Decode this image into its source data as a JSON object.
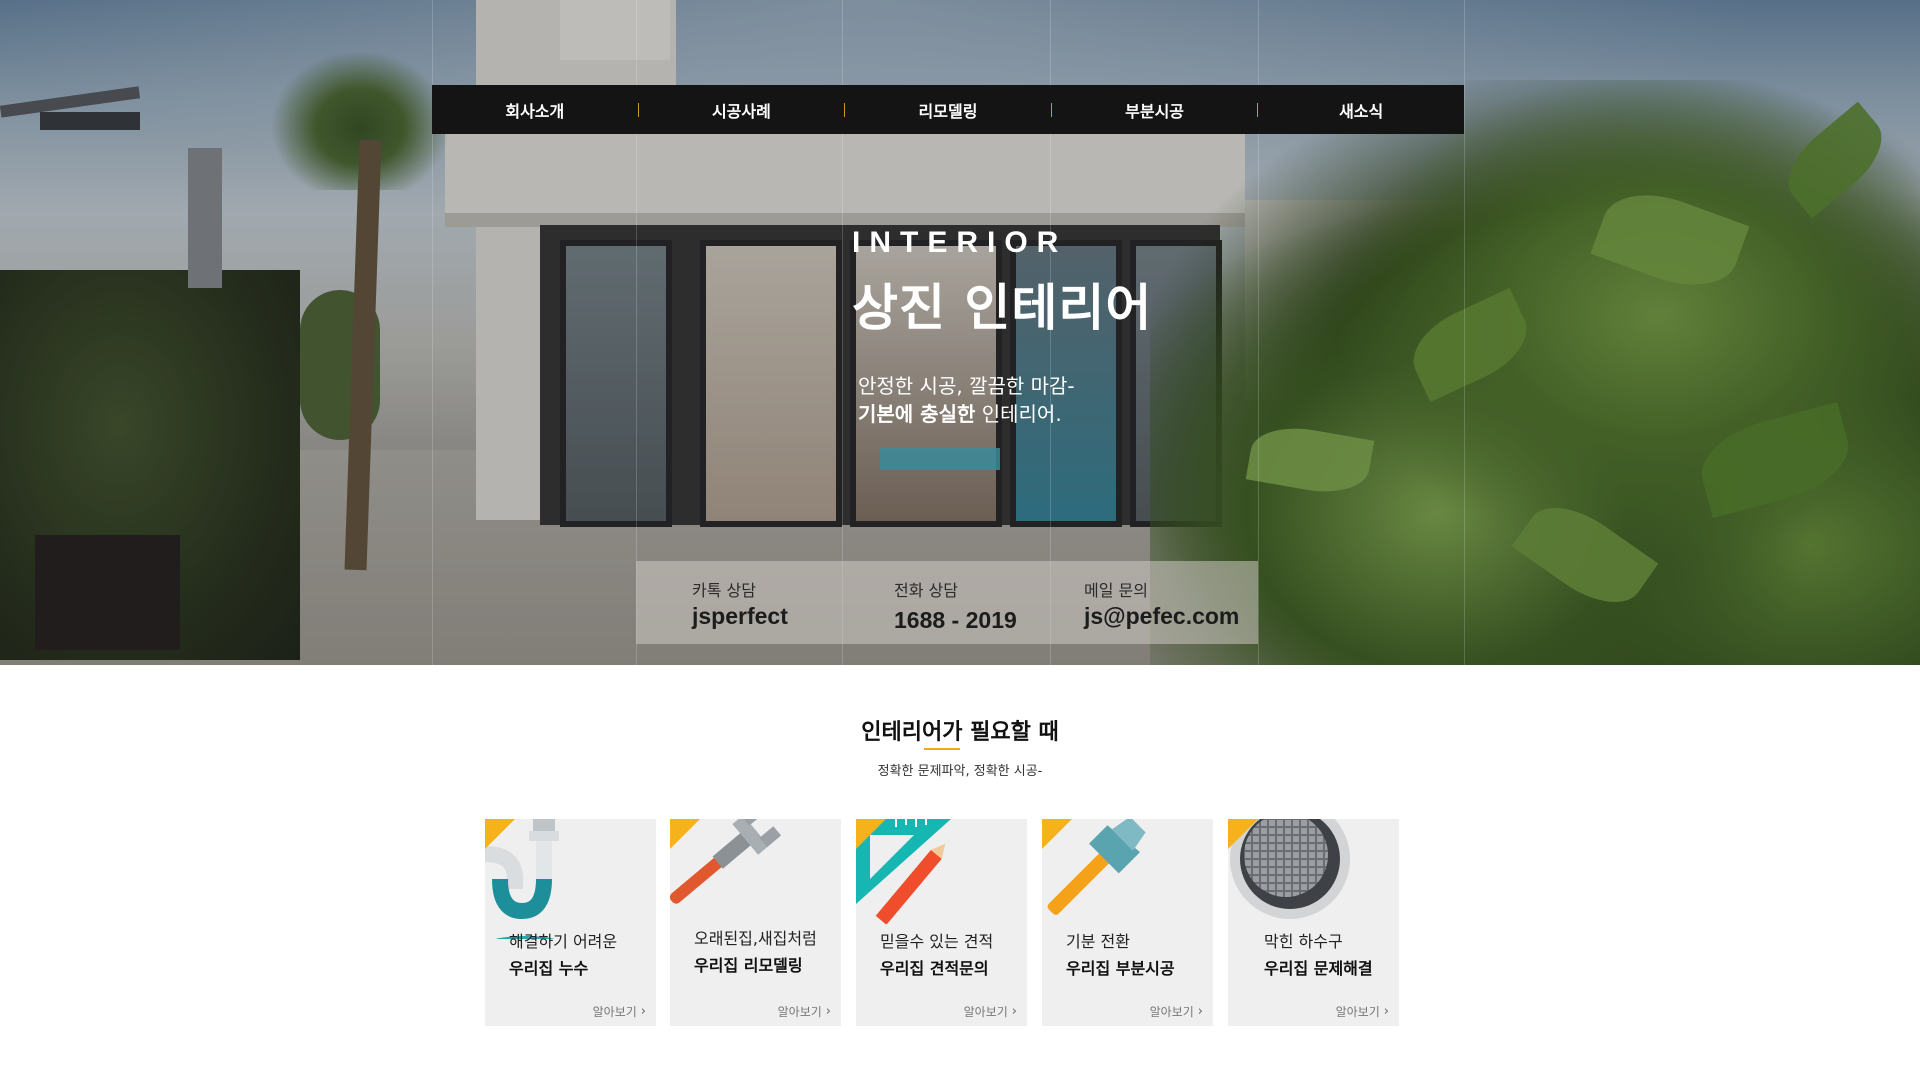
{
  "nav": {
    "items": [
      {
        "label": "회사소개"
      },
      {
        "label": "시공사례"
      },
      {
        "label": "리모델링"
      },
      {
        "label": "부분시공"
      },
      {
        "label": "새소식"
      }
    ]
  },
  "hero": {
    "eyebrow": "INTERIOR",
    "title": "상진 인테리어",
    "line1": "안정한 시공, 깔끔한 마감-",
    "line2_bold": "기본에 충실한",
    "line2_rest": " 인테리어.",
    "contacts": [
      {
        "label": "카톡 상담",
        "value": "jsperfect"
      },
      {
        "label": "전화 상담",
        "value": "1688 - 2019"
      },
      {
        "label": "메일 문의",
        "value": "js@pefec.com"
      }
    ]
  },
  "section": {
    "title": "인테리어가 필요할 때",
    "subtitle": "정확한 문제파악, 정확한 시공-",
    "more_label": "알아보기",
    "cards": [
      {
        "icon": "pipe-leak-icon",
        "line1": "해결하기 어려운",
        "line2": "우리집 누수"
      },
      {
        "icon": "wrench-icon",
        "line1": "오래된집,새집처럼",
        "line2": "우리집 리모델링"
      },
      {
        "icon": "ruler-pencil-icon",
        "line1": "믿을수 있는 견적",
        "line2": "우리집 견적문의"
      },
      {
        "icon": "hammer-icon",
        "line1": "기분 전환",
        "line2": "우리집 부분시공"
      },
      {
        "icon": "drain-cover-icon",
        "line1": "막힌 하수구",
        "line2": "우리집 문제해결"
      }
    ]
  },
  "colors": {
    "accent": "#f5b21b",
    "nav_bg": "#141414",
    "card_bg": "#efefef"
  }
}
